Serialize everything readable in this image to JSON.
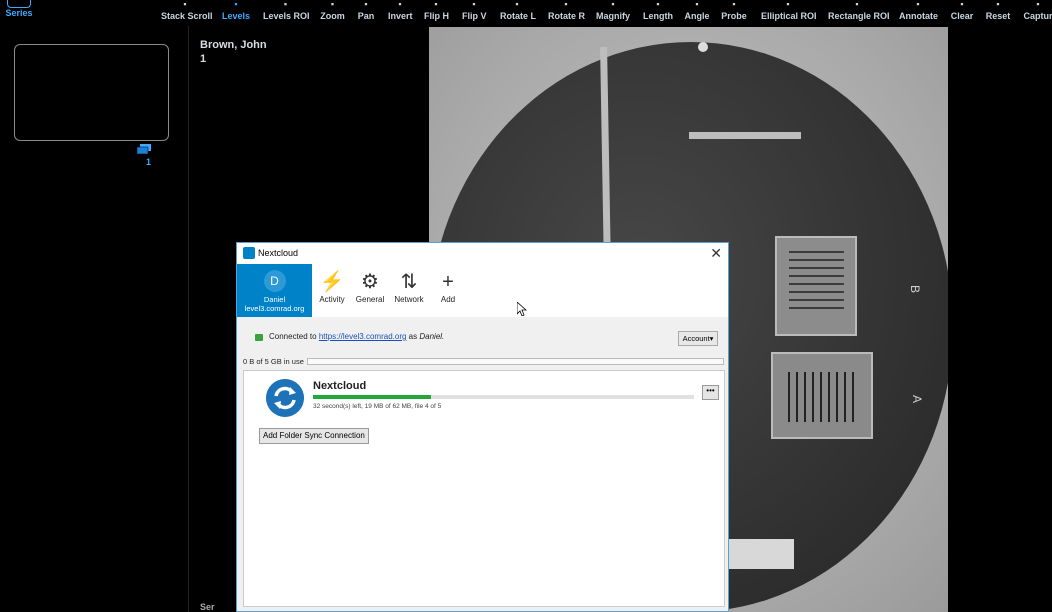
{
  "toolbar": {
    "series_label": "Series",
    "items": [
      {
        "label": "Stack Scroll",
        "icon": "stack-scroll-icon"
      },
      {
        "label": "Levels",
        "icon": "levels-icon"
      },
      {
        "label": "Levels ROI",
        "icon": "levels-roi-icon"
      },
      {
        "label": "Zoom",
        "icon": "zoom-icon"
      },
      {
        "label": "Pan",
        "icon": "pan-icon"
      },
      {
        "label": "Invert",
        "icon": "invert-icon"
      },
      {
        "label": "Flip H",
        "icon": "flip-h-icon"
      },
      {
        "label": "Flip V",
        "icon": "flip-v-icon"
      },
      {
        "label": "Rotate L",
        "icon": "rotate-l-icon"
      },
      {
        "label": "Rotate R",
        "icon": "rotate-r-icon"
      },
      {
        "label": "Magnify",
        "icon": "magnify-icon"
      },
      {
        "label": "Length",
        "icon": "length-icon"
      },
      {
        "label": "Angle",
        "icon": "angle-icon"
      },
      {
        "label": "Probe",
        "icon": "probe-icon"
      },
      {
        "label": "Elliptical ROI",
        "icon": "elliptical-roi-icon"
      },
      {
        "label": "Rectangle ROI",
        "icon": "rectangle-roi-icon"
      },
      {
        "label": "Annotate",
        "icon": "annotate-icon"
      },
      {
        "label": "Clear",
        "icon": "clear-icon"
      },
      {
        "label": "Reset",
        "icon": "reset-icon"
      },
      {
        "label": "Captur",
        "icon": "capture-icon"
      }
    ],
    "active_item": "Levels",
    "accent_color": "#3fa9ff"
  },
  "left_panel": {
    "thumbnail_count": "1",
    "footer_label": "Ser"
  },
  "viewer": {
    "patient_name": "Brown, John",
    "patient_number": "1",
    "image_markers": [
      "B",
      "A"
    ]
  },
  "nextcloud": {
    "window_title": "Nextcloud",
    "close_label": "✕",
    "account": {
      "avatar_letter": "D",
      "user": "Daniel",
      "server": "level3.comrad.org"
    },
    "tools": [
      {
        "label": "Activity",
        "icon": "activity-icon",
        "glyph": "⚡"
      },
      {
        "label": "General",
        "icon": "gear-icon",
        "glyph": "⚙"
      },
      {
        "label": "Network",
        "icon": "network-icon",
        "glyph": "⇅"
      },
      {
        "label": "Add",
        "icon": "add-icon",
        "glyph": "+"
      }
    ],
    "connection": {
      "prefix": "Connected to",
      "url": "https://level3.comrad.org",
      "as": "as",
      "user": "Daniel."
    },
    "account_button": "Account▾",
    "usage_text": "0 B of 5 GB in use",
    "folder": {
      "name": "Nextcloud",
      "status": "32 second(s) left, 19 MB of 62 MB, file 4 of 5",
      "progress_fraction": 0.31,
      "more_label": "•••"
    },
    "add_folder_button": "Add Folder Sync Connection",
    "brand_color": "#0082c9"
  }
}
